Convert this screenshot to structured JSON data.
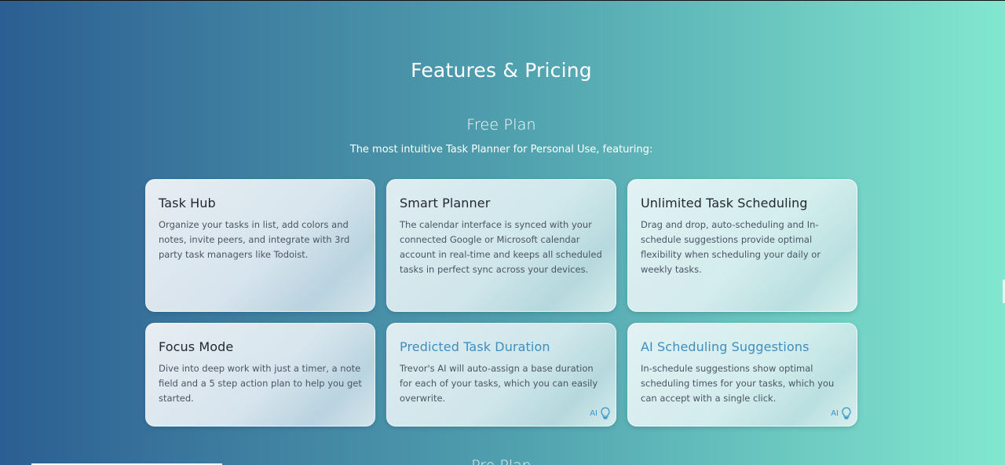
{
  "page": {
    "title": "Features & Pricing",
    "plan_title": "Free Plan",
    "plan_subtitle": "The most intuitive Task Planner for Personal Use, featuring:",
    "next_section_title": "Pro Plan"
  },
  "features": [
    {
      "title": "Task Hub",
      "description": "Organize your tasks in list, add colors and notes, invite peers, and integrate with 3rd party task managers like Todoist."
    },
    {
      "title": "Smart Planner",
      "description": "The calendar interface is synced with your connected Google or Microsoft calendar account in real-time and keeps all scheduled tasks in perfect sync across your devices."
    },
    {
      "title": "Unlimited Task Scheduling",
      "description": "Drag and drop, auto-scheduling and In-schedule suggestions provide optimal flexibility when scheduling your daily or weekly tasks."
    },
    {
      "title": "Focus Mode",
      "description": "Dive into deep work with just a timer, a note field and a 5 step action plan to help you get started."
    },
    {
      "title": "Predicted Task Duration",
      "description": "Trevor's AI will auto-assign a base duration for each of your tasks, which you can easily overwrite.",
      "badge": "AI",
      "icon": "lightbulb-icon"
    },
    {
      "title": "AI Scheduling Suggestions",
      "description": "In-schedule suggestions show optimal scheduling times for your tasks, which you can accept with a single click.",
      "badge": "AI",
      "icon": "lightbulb-icon"
    }
  ],
  "colors": {
    "gradient_start": "#2b5e92",
    "gradient_end": "#82e7cf",
    "ai_accent": "#3c8fc0"
  }
}
